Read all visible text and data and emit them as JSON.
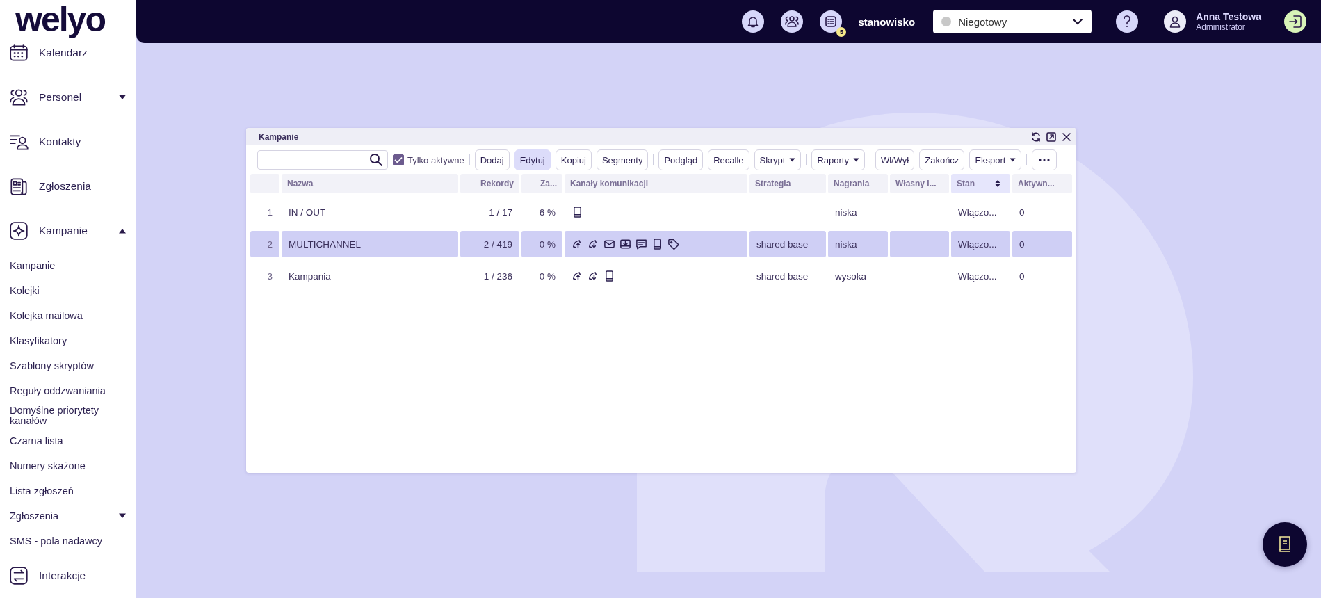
{
  "logo": "welyo",
  "sidebar": {
    "items": [
      {
        "label": "Kalendarz",
        "kind": "calendar"
      },
      {
        "label": "Personel",
        "kind": "people",
        "expanded": false
      },
      {
        "label": "Kontakty",
        "kind": "contacts"
      },
      {
        "label": "Zgłoszenia",
        "kind": "document"
      },
      {
        "label": "Kampanie",
        "kind": "sparkle",
        "expanded": true,
        "children": [
          {
            "label": "Kampanie"
          },
          {
            "label": "Kolejki"
          },
          {
            "label": "Kolejka mailowa"
          },
          {
            "label": "Klasyfikatory"
          },
          {
            "label": "Szablony skryptów"
          },
          {
            "label": "Reguły oddzwaniania"
          },
          {
            "label": "Domyślne priorytety kanałów"
          },
          {
            "label": "Czarna lista"
          },
          {
            "label": "Numery skażone"
          },
          {
            "label": "Lista zgłoszeń"
          },
          {
            "label": "Zgłoszenia",
            "expanded": false
          },
          {
            "label": "SMS - pola nadawcy"
          }
        ]
      },
      {
        "label": "Interakcje",
        "kind": "arrows"
      }
    ]
  },
  "topbar": {
    "tasks_badge": "5",
    "workstation": "stanowisko",
    "status": "Niegotowy",
    "user_name": "Anna Testowa",
    "user_role": "Administrator"
  },
  "window": {
    "title": "Kampanie",
    "only_active": {
      "label": "Tylko aktywne",
      "checked": true
    },
    "toolbar": [
      [
        {
          "label": "Dodaj",
          "kind": "text",
          "highlighted": false
        },
        {
          "label": "Edytuj",
          "kind": "text",
          "highlighted": true
        },
        {
          "label": "Kopiuj",
          "kind": "text",
          "highlighted": false
        },
        {
          "label": "Segmenty",
          "kind": "text",
          "highlighted": false
        }
      ],
      [
        {
          "label": "Podgląd",
          "kind": "text",
          "highlighted": false
        },
        {
          "label": "Recalle",
          "kind": "text",
          "highlighted": false
        },
        {
          "label": "Skrypt",
          "kind": "menu",
          "highlighted": false
        }
      ],
      [
        {
          "label": "Raporty",
          "kind": "menu",
          "highlighted": false
        }
      ],
      [
        {
          "label": "Wł/Wył",
          "kind": "text",
          "highlighted": false
        },
        {
          "label": "Zakończ",
          "kind": "text",
          "highlighted": false
        },
        {
          "label": "Eksport",
          "kind": "menu",
          "highlighted": false
        }
      ],
      [
        {
          "kind": "more",
          "highlighted": false
        }
      ]
    ],
    "table": {
      "columns": [
        {
          "label": "Nazwa",
          "sorted": false
        },
        {
          "label": "Rekordy",
          "sorted": false
        },
        {
          "label": "Za...",
          "sorted": false
        },
        {
          "label": "Kanały komunikacji",
          "sorted": false
        },
        {
          "label": "Strategia",
          "sorted": false
        },
        {
          "label": "Nagrania",
          "sorted": false
        },
        {
          "label": "Własny I...",
          "sorted": false
        },
        {
          "label": "Stan",
          "sorted": true
        },
        {
          "label": "Aktywn...",
          "sorted": false
        }
      ],
      "rows": [
        {
          "number": "1",
          "selected": false,
          "name": "IN / OUT",
          "records": "1 / 17",
          "column_3": "6 %",
          "channels": [
            {
              "kind": "mobile"
            }
          ],
          "recordings": "niska",
          "status": "Włączo...",
          "active": "0"
        },
        {
          "number": "2",
          "selected": true,
          "name": "MULTICHANNEL",
          "records": "2 / 419",
          "column_3": "0 %",
          "channels": [
            {
              "kind": "outbound"
            },
            {
              "kind": "inbound"
            },
            {
              "kind": "email"
            },
            {
              "kind": "download"
            },
            {
              "kind": "chat"
            },
            {
              "kind": "mobile"
            },
            {
              "kind": "tag"
            }
          ],
          "strategy": "shared base",
          "recordings": "niska",
          "status": "Włączo...",
          "active": "0"
        },
        {
          "number": "3",
          "selected": false,
          "name": "Kampania",
          "records": "1 / 236",
          "column_3": "0 %",
          "channels": [
            {
              "kind": "outbound"
            },
            {
              "kind": "inbound"
            },
            {
              "kind": "mobile"
            }
          ],
          "strategy": "shared base",
          "recordings": "wysoka",
          "status": "Włączo...",
          "active": "0"
        }
      ]
    }
  }
}
